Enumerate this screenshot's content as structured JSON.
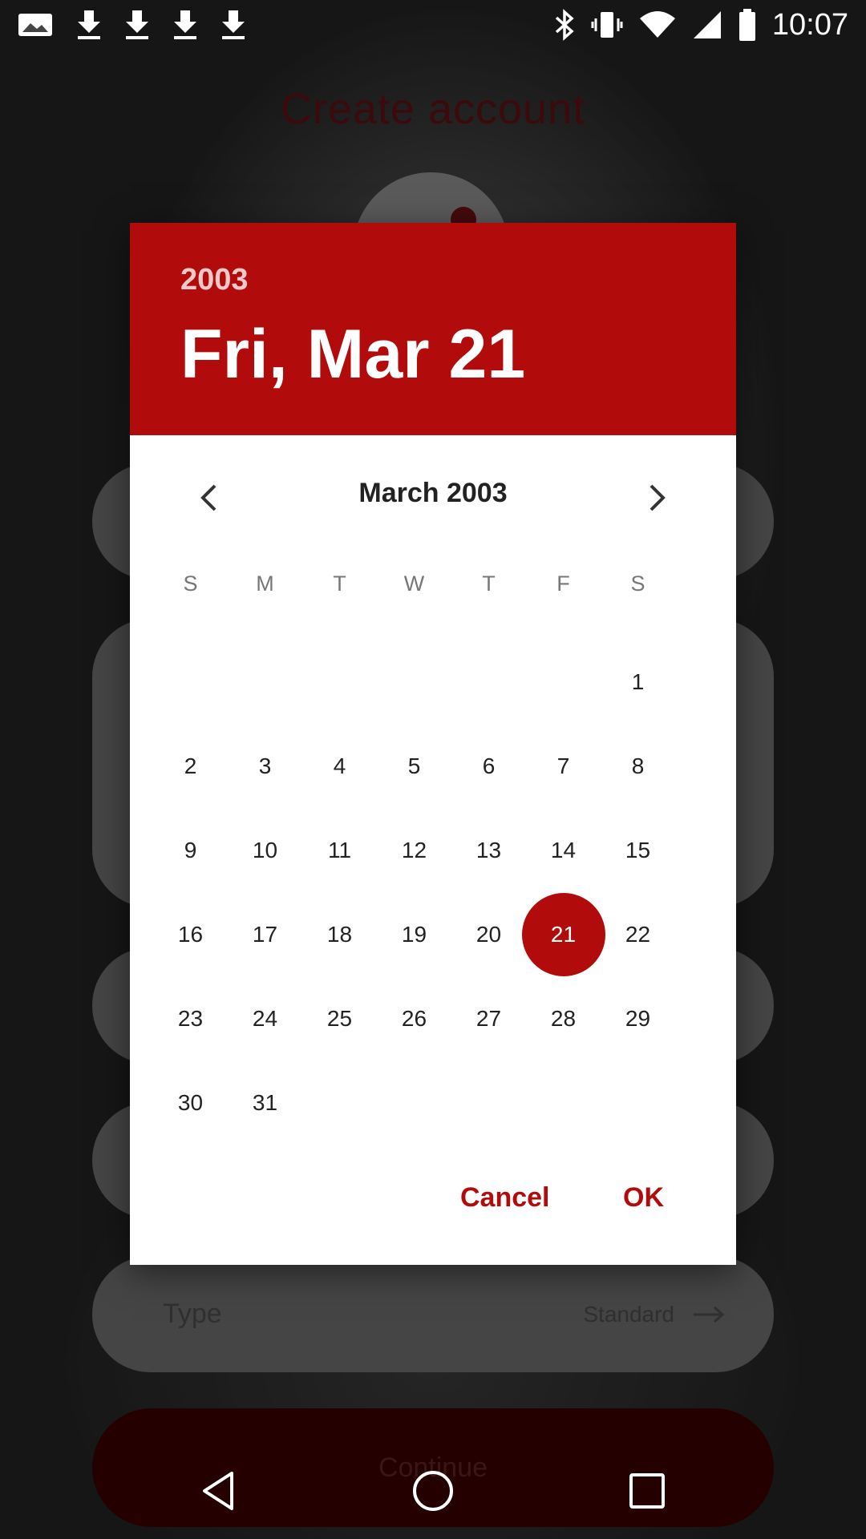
{
  "status_bar": {
    "time": "10:07"
  },
  "background": {
    "title": "Create account",
    "type_label": "Type",
    "type_value": "Standard",
    "continue_label": "Continue"
  },
  "dialog": {
    "year": "2003",
    "date_label": "Fri, Mar 21",
    "month_title": "March 2003",
    "weekdays": [
      "S",
      "M",
      "T",
      "W",
      "T",
      "F",
      "S"
    ],
    "weeks": [
      [
        "",
        "",
        "",
        "",
        "",
        "",
        "1"
      ],
      [
        "2",
        "3",
        "4",
        "5",
        "6",
        "7",
        "8"
      ],
      [
        "9",
        "10",
        "11",
        "12",
        "13",
        "14",
        "15"
      ],
      [
        "16",
        "17",
        "18",
        "19",
        "20",
        "21",
        "22"
      ],
      [
        "23",
        "24",
        "25",
        "26",
        "27",
        "28",
        "29"
      ],
      [
        "30",
        "31",
        "",
        "",
        "",
        "",
        ""
      ]
    ],
    "selected_day": "21",
    "cancel_label": "Cancel",
    "ok_label": "OK",
    "accent_color": "#b20b0b"
  }
}
